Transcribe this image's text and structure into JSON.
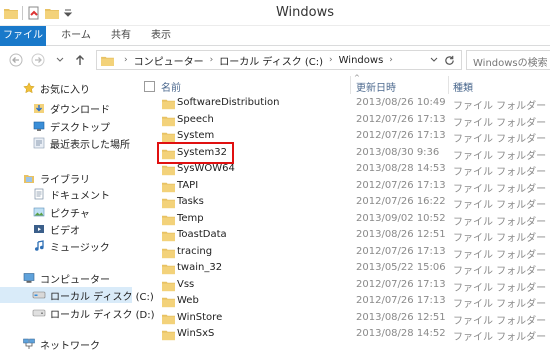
{
  "window": {
    "title": "Windows"
  },
  "ribbon": {
    "tabs": [
      {
        "label": "ファイル",
        "active": true
      },
      {
        "label": "ホーム"
      },
      {
        "label": "共有"
      },
      {
        "label": "表示"
      }
    ],
    "accent": "#1979ca"
  },
  "address": {
    "path": [
      "コンピューター",
      "ローカル ディスク (C:)",
      "Windows"
    ],
    "search_placeholder": "Windowsの検索"
  },
  "columns": {
    "name": "名前",
    "date": "更新日時",
    "type": "種類"
  },
  "nav": {
    "favorites": {
      "label": "お気に入り",
      "items": [
        "ダウンロード",
        "デスクトップ",
        "最近表示した場所"
      ]
    },
    "libraries": {
      "label": "ライブラリ",
      "items": [
        "ドキュメント",
        "ピクチャ",
        "ビデオ",
        "ミュージック"
      ]
    },
    "computer": {
      "label": "コンピューター",
      "items": [
        "ローカル ディスク (C:)",
        "ローカル ディスク (D:)"
      ]
    },
    "network": {
      "label": "ネットワーク"
    }
  },
  "files": [
    {
      "name": "SoftwareDistribution",
      "date": "2013/08/26 10:49",
      "type": "ファイル フォルダー"
    },
    {
      "name": "Speech",
      "date": "2012/07/26 17:13",
      "type": "ファイル フォルダー"
    },
    {
      "name": "System",
      "date": "2012/07/26 17:13",
      "type": "ファイル フォルダー"
    },
    {
      "name": "System32",
      "date": "2013/08/30 9:36",
      "type": "ファイル フォルダー",
      "highlighted": true
    },
    {
      "name": "SysWOW64",
      "date": "2013/08/28 14:53",
      "type": "ファイル フォルダー"
    },
    {
      "name": "TAPI",
      "date": "2012/07/26 17:13",
      "type": "ファイル フォルダー"
    },
    {
      "name": "Tasks",
      "date": "2012/07/26 16:22",
      "type": "ファイル フォルダー"
    },
    {
      "name": "Temp",
      "date": "2013/09/02 10:52",
      "type": "ファイル フォルダー"
    },
    {
      "name": "ToastData",
      "date": "2013/08/26 12:51",
      "type": "ファイル フォルダー"
    },
    {
      "name": "tracing",
      "date": "2012/07/26 17:13",
      "type": "ファイル フォルダー"
    },
    {
      "name": "twain_32",
      "date": "2013/05/22 15:06",
      "type": "ファイル フォルダー"
    },
    {
      "name": "Vss",
      "date": "2012/07/26 17:13",
      "type": "ファイル フォルダー"
    },
    {
      "name": "Web",
      "date": "2012/07/26 17:13",
      "type": "ファイル フォルダー"
    },
    {
      "name": "WinStore",
      "date": "2013/08/26 12:51",
      "type": "ファイル フォルダー"
    },
    {
      "name": "WinSxS",
      "date": "2013/08/28 14:52",
      "type": "ファイル フォルダー"
    }
  ]
}
